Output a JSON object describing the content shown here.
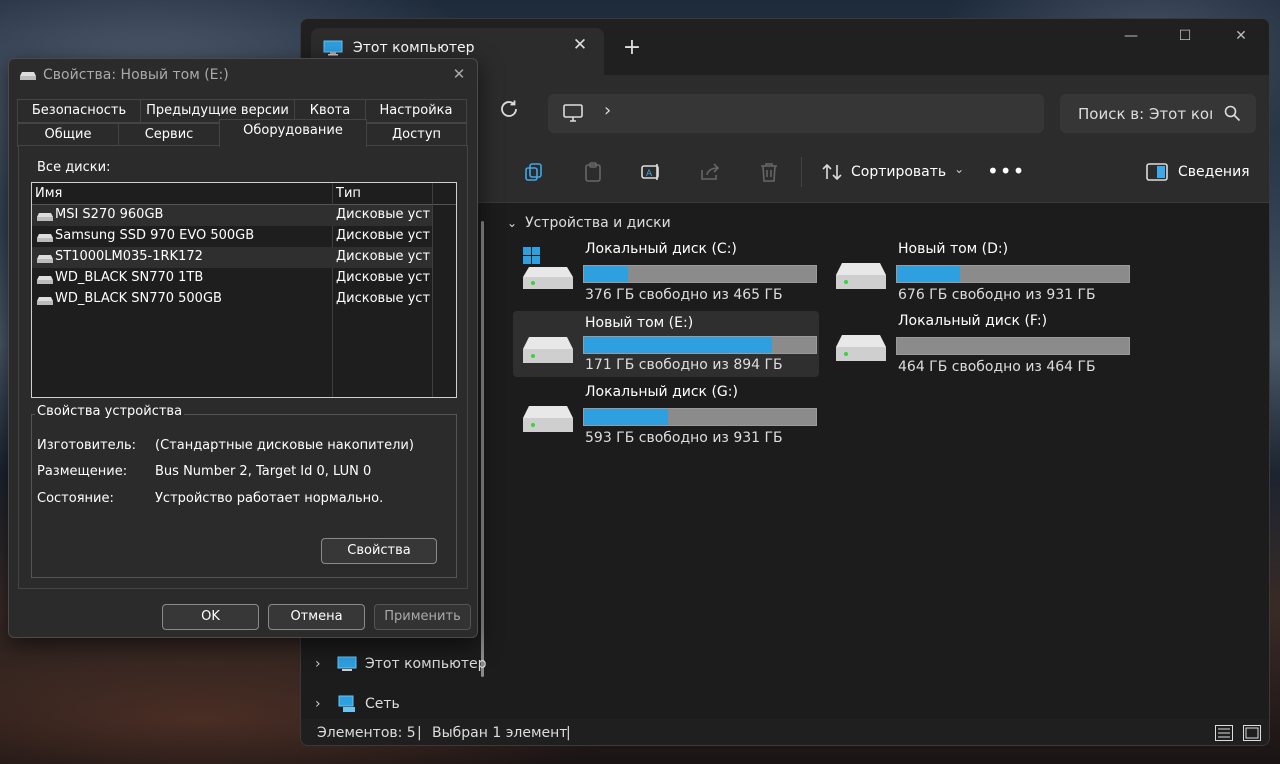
{
  "explorer": {
    "tab_title": "Этот компьютер",
    "tab_close": "✕",
    "new_tab": "+",
    "win_min": "—",
    "win_max": "☐",
    "win_close": "✕",
    "address_chevron": "›",
    "search_placeholder": "Поиск в: Этот компьютер",
    "toolbar": {
      "sort_label": "Сортировать",
      "sort_chevron": "⌄",
      "more": "•••",
      "details_label": "Сведения"
    },
    "group_label": "Устройства и диски",
    "drives": [
      {
        "name": "Локальный диск (C:)",
        "free": "376 ГБ свободно из 465 ГБ",
        "used_fraction": 0.19
      },
      {
        "name": "Новый том (D:)",
        "free": "676 ГБ свободно из 931 ГБ",
        "used_fraction": 0.27
      },
      {
        "name": "Новый том (E:)",
        "free": "171 ГБ свободно из 894 ГБ",
        "used_fraction": 0.81
      },
      {
        "name": "Локальный диск (F:)",
        "free": "464 ГБ свободно из 464 ГБ",
        "used_fraction": 0.0
      },
      {
        "name": "Локальный диск (G:)",
        "free": "593 ГБ свободно из 931 ГБ",
        "used_fraction": 0.36
      }
    ],
    "nav": [
      {
        "label": "Этот компьютер"
      },
      {
        "label": "Сеть"
      }
    ],
    "status": {
      "count": "Элементов: 5",
      "selected": "Выбран 1 элемент"
    },
    "colors": {
      "usage_bar": "#2ea0e0",
      "window_bg": "#1f1f1f"
    }
  },
  "dialog": {
    "title": "Свойства: Новый том (E:)",
    "close": "✕",
    "tabs_row1": [
      "Безопасность",
      "Предыдущие версии",
      "Квота",
      "Настройка"
    ],
    "tabs_row2": [
      "Общие",
      "Сервис",
      "Оборудование",
      "Доступ"
    ],
    "active_tab": "Оборудование",
    "all_disks_label": "Все диски:",
    "columns": {
      "name": "Имя",
      "type": "Тип"
    },
    "disks": [
      {
        "name": "MSI S270 960GB",
        "type": "Дисковые устройства"
      },
      {
        "name": "Samsung SSD 970 EVO 500GB",
        "type": "Дисковые устройства"
      },
      {
        "name": "ST1000LM035-1RK172",
        "type": "Дисковые устройства"
      },
      {
        "name": "WD_BLACK SN770 1TB",
        "type": "Дисковые устройства"
      },
      {
        "name": "WD_BLACK SN770 500GB",
        "type": "Дисковые устройства"
      }
    ],
    "device_props_label": "Свойства устройства",
    "manufacturer_label": "Изготовитель:",
    "manufacturer_value": "(Стандартные дисковые накопители)",
    "location_label": "Размещение:",
    "location_value": "Bus Number 2, Target Id 0, LUN 0",
    "state_label": "Состояние:",
    "state_value": "Устройство работает нормально.",
    "properties_button": "Свойства",
    "ok": "OK",
    "cancel": "Отмена",
    "apply": "Применить"
  }
}
